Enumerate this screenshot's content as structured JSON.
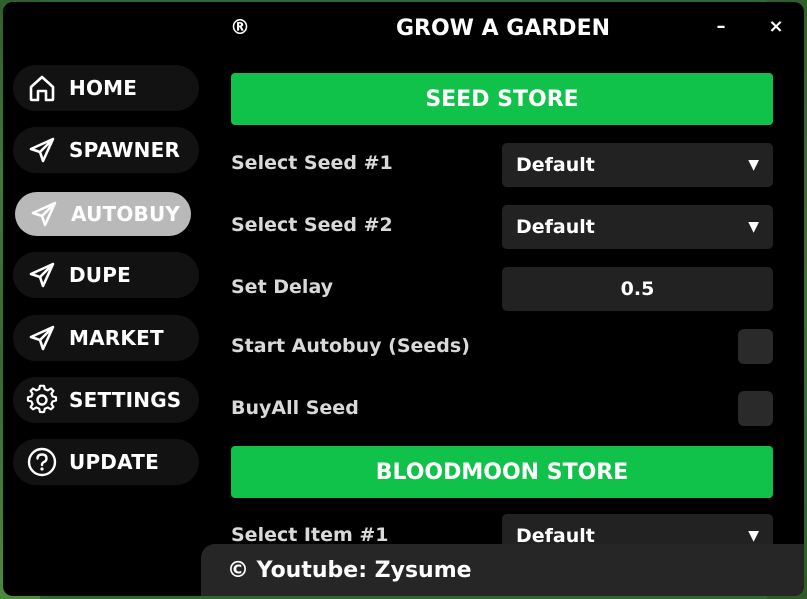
{
  "header": {
    "logo_symbol": "®",
    "title": "GROW A GARDEN",
    "minimize_label": "–",
    "close_label": "×"
  },
  "sidebar": {
    "items": [
      {
        "label": "HOME",
        "icon": "home-icon",
        "active": false
      },
      {
        "label": "SPAWNER",
        "icon": "send-icon",
        "active": false
      },
      {
        "label": "AUTOBUY",
        "icon": "send-icon",
        "active": true
      },
      {
        "label": "DUPE",
        "icon": "send-icon",
        "active": false
      },
      {
        "label": "MARKET",
        "icon": "send-icon",
        "active": false
      },
      {
        "label": "SETTINGS",
        "icon": "gear-icon",
        "active": false
      },
      {
        "label": "UPDATE",
        "icon": "question-icon",
        "active": false
      }
    ]
  },
  "main": {
    "seed_store": {
      "title": "SEED STORE",
      "select_seed_1": {
        "label": "Select Seed #1",
        "value": "Default"
      },
      "select_seed_2": {
        "label": "Select Seed #2",
        "value": "Default"
      },
      "set_delay": {
        "label": "Set Delay",
        "value": "0.5"
      },
      "start_autobuy": {
        "label": "Start Autobuy (Seeds)",
        "checked": false
      },
      "buyall_seed": {
        "label": "BuyAll Seed",
        "checked": false
      }
    },
    "bloodmoon_store": {
      "title": "BLOODMOON STORE",
      "select_item_1": {
        "label": "Select Item #1",
        "value": "Default"
      }
    }
  },
  "footer": {
    "text": "© Youtube: Zysume"
  },
  "colors": {
    "accent": "#10c24a",
    "background": "#000000",
    "control": "#222222",
    "active_nav": "#b9b9b9"
  }
}
